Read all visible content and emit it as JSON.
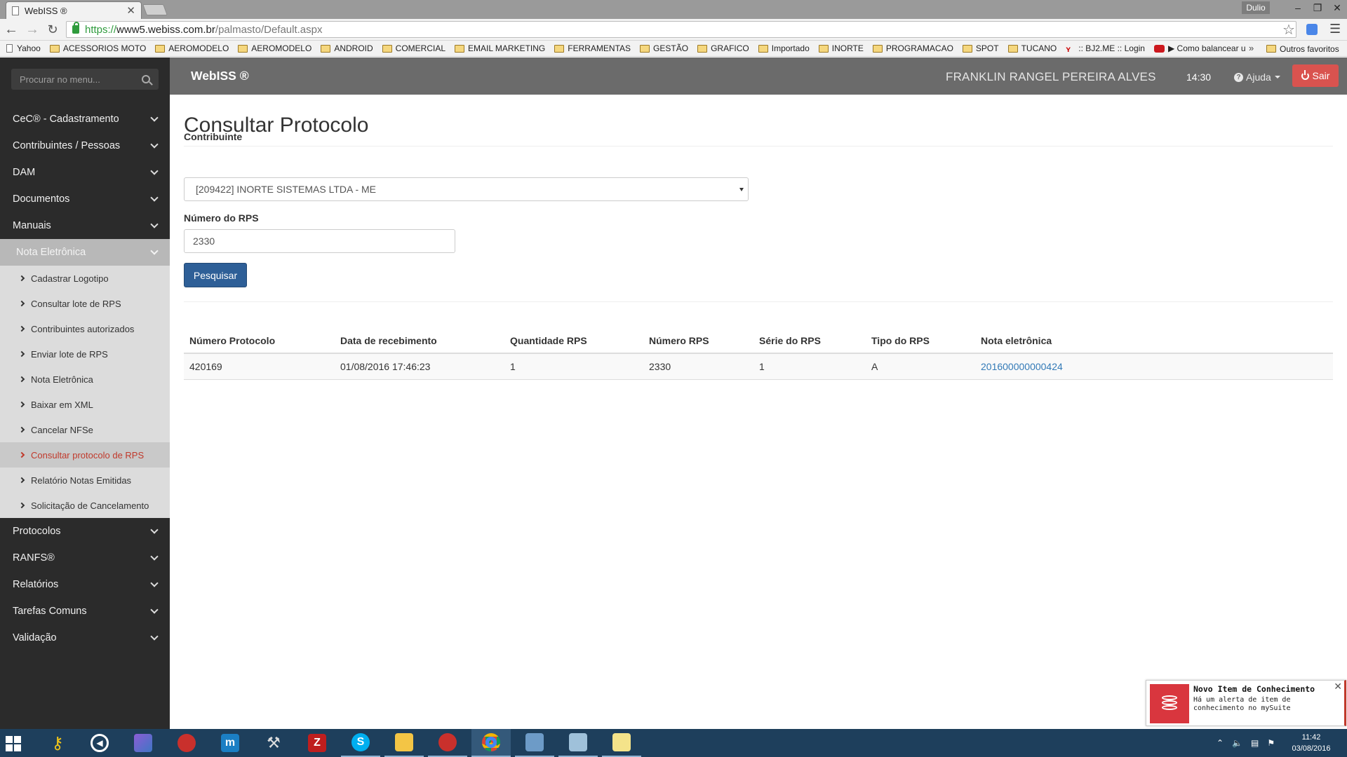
{
  "browser": {
    "tab_title": "WebISS ®",
    "profile": "Dulio",
    "url": {
      "scheme": "https://",
      "host": "www5.webiss.com.br",
      "path": "/palmasto/Default.aspx"
    },
    "bookmarks": [
      {
        "label": "Yahoo",
        "icon": "page-icon"
      },
      {
        "label": "ACESSORIOS MOTO",
        "icon": "folder-icon"
      },
      {
        "label": "AEROMODELO",
        "icon": "folder-icon"
      },
      {
        "label": "AEROMODELO",
        "icon": "folder-icon"
      },
      {
        "label": "ANDROID",
        "icon": "folder-icon"
      },
      {
        "label": "COMERCIAL",
        "icon": "folder-icon"
      },
      {
        "label": "EMAIL MARKETING",
        "icon": "folder-icon"
      },
      {
        "label": "FERRAMENTAS",
        "icon": "folder-icon"
      },
      {
        "label": "GESTÃO",
        "icon": "folder-icon"
      },
      {
        "label": "GRAFICO",
        "icon": "folder-icon"
      },
      {
        "label": "Importado",
        "icon": "folder-icon"
      },
      {
        "label": "INORTE",
        "icon": "folder-icon"
      },
      {
        "label": "PROGRAMACAO",
        "icon": "folder-icon"
      },
      {
        "label": "SPOT",
        "icon": "folder-icon"
      },
      {
        "label": "TUCANO",
        "icon": "folder-icon"
      },
      {
        "label": ":: BJ2.ME :: Login",
        "icon": "bj-icon"
      },
      {
        "label": "▶ Como balancear u",
        "icon": "yt-icon"
      }
    ],
    "bookmarks_more": "»",
    "other_bookmarks": "Outros favoritos"
  },
  "sidebar": {
    "search_placeholder": "Procurar no menu...",
    "items_top": [
      {
        "label": "CeC® - Cadastramento"
      },
      {
        "label": "Contribuintes / Pessoas"
      },
      {
        "label": "DAM"
      },
      {
        "label": "Documentos"
      },
      {
        "label": "Manuais"
      }
    ],
    "open_item": {
      "label": "Nota Eletrônica"
    },
    "subitems": [
      {
        "label": "Cadastrar Logotipo",
        "active": false
      },
      {
        "label": "Consultar lote de RPS",
        "active": false
      },
      {
        "label": "Contribuintes autorizados",
        "active": false
      },
      {
        "label": "Enviar lote de RPS",
        "active": false
      },
      {
        "label": "Nota Eletrônica",
        "active": false
      },
      {
        "label": "Baixar em XML",
        "active": false
      },
      {
        "label": "Cancelar NFSe",
        "active": false
      },
      {
        "label": "Consultar protocolo de RPS",
        "active": true
      },
      {
        "label": "Relatório Notas Emitidas",
        "active": false
      },
      {
        "label": "Solicitação de Cancelamento",
        "active": false
      }
    ],
    "items_bottom": [
      {
        "label": "Protocolos"
      },
      {
        "label": "RANFS®"
      },
      {
        "label": "Relatórios"
      },
      {
        "label": "Tarefas Comuns"
      },
      {
        "label": "Validação"
      }
    ]
  },
  "topbar": {
    "brand": "WebISS ®",
    "user": "FRANKLIN RANGEL PEREIRA ALVES",
    "time": "14:30",
    "help": "Ajuda",
    "logout": "Sair"
  },
  "main": {
    "title": "Consultar Protocolo",
    "contribuinte_label": "Contribuinte",
    "contribuinte_value": "[209422] INORTE SISTEMAS LTDA - ME",
    "rps_label": "Número do RPS",
    "rps_value": "2330",
    "search_button": "Pesquisar",
    "table": {
      "headers": [
        "Número Protocolo",
        "Data de recebimento",
        "Quantidade RPS",
        "Número RPS",
        "Série do RPS",
        "Tipo do RPS",
        "Nota eletrônica"
      ],
      "rows": [
        [
          "420169",
          "01/08/2016 17:46:23",
          "1",
          "2330",
          "1",
          "A",
          "201600000000424"
        ]
      ]
    }
  },
  "toast": {
    "title": "Novo Item de Conhecimento",
    "message": "Há um alerta de item de conhecimento no mySuite"
  },
  "taskbar": {
    "clock_time": "11:42",
    "clock_date": "03/08/2016"
  },
  "colors": {
    "sidebar_bg": "#2b2b2b",
    "topbar_bg": "#6b6b6b",
    "primary_button": "#2e5f97",
    "danger_button": "#d9534f",
    "active_menu_text": "#c0392b",
    "link": "#337ab7"
  }
}
